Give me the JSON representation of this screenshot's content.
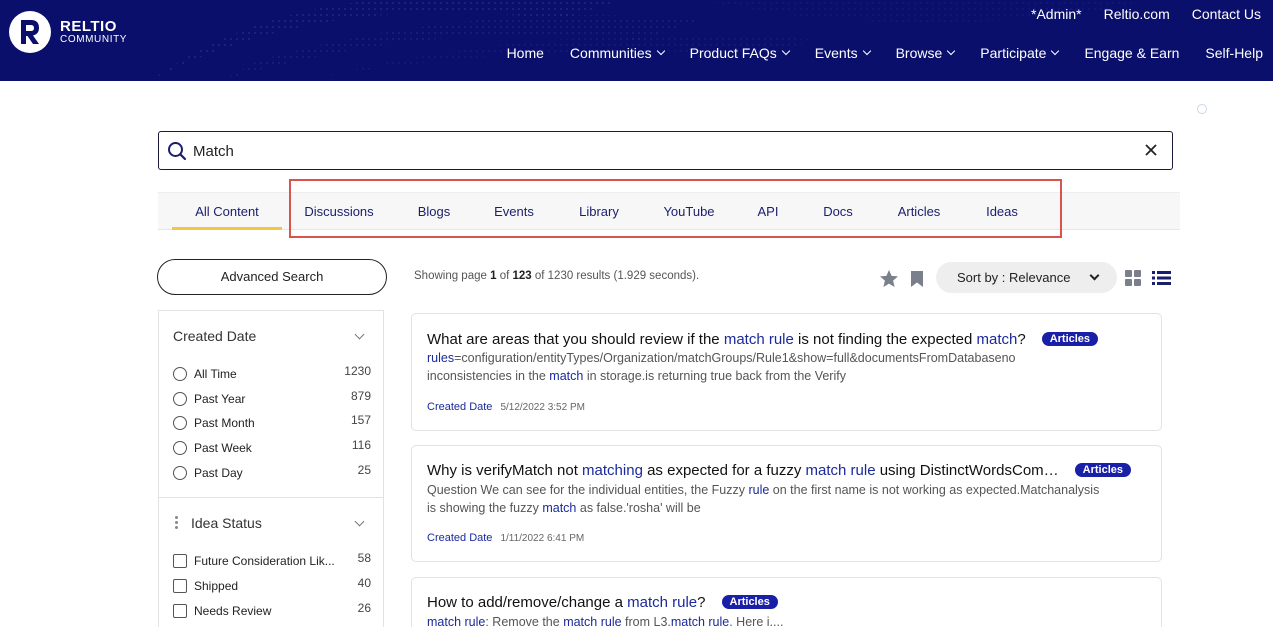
{
  "header": {
    "logo_name": "RELTIO",
    "logo_sub": "COMMUNITY",
    "top_links": [
      "*Admin*",
      "Reltio.com",
      "Contact Us"
    ],
    "nav": [
      {
        "label": "Home",
        "dropdown": false
      },
      {
        "label": "Communities",
        "dropdown": true
      },
      {
        "label": "Product FAQs",
        "dropdown": true
      },
      {
        "label": "Events",
        "dropdown": true
      },
      {
        "label": "Browse",
        "dropdown": true
      },
      {
        "label": "Participate",
        "dropdown": true
      },
      {
        "label": "Engage & Earn",
        "dropdown": false
      },
      {
        "label": "Self-Help",
        "dropdown": false
      }
    ]
  },
  "search": {
    "value": "Match",
    "icon": "search-icon",
    "clear_icon": "close-icon"
  },
  "tabs": [
    {
      "label": "All Content",
      "active": true
    },
    {
      "label": "Discussions",
      "active": false
    },
    {
      "label": "Blogs",
      "active": false
    },
    {
      "label": "Events",
      "active": false
    },
    {
      "label": "Library",
      "active": false
    },
    {
      "label": "YouTube",
      "active": false
    },
    {
      "label": "API",
      "active": false
    },
    {
      "label": "Docs",
      "active": false
    },
    {
      "label": "Articles",
      "active": false
    },
    {
      "label": "Ideas",
      "active": false
    }
  ],
  "sidebar": {
    "advanced_search_label": "Advanced Search",
    "created_date": {
      "title": "Created Date",
      "options": [
        {
          "label": "All Time",
          "count": "1230"
        },
        {
          "label": "Past Year",
          "count": "879"
        },
        {
          "label": "Past Month",
          "count": "157"
        },
        {
          "label": "Past Week",
          "count": "116"
        },
        {
          "label": "Past Day",
          "count": "25"
        }
      ]
    },
    "idea_status": {
      "title": "Idea Status",
      "options": [
        {
          "label": "Future Consideration Lik...",
          "count": "58"
        },
        {
          "label": "Shipped",
          "count": "40"
        },
        {
          "label": "Needs Review",
          "count": "26"
        }
      ]
    }
  },
  "results": {
    "info_prefix": "Showing page ",
    "page": "1",
    "of": " of ",
    "total_pages": "123",
    "info_suffix": " of 1230 results (1.929 seconds).",
    "sort_label": "Sort by : Relevance",
    "items": [
      {
        "title_parts": [
          {
            "text": "What are areas that you should review if the ",
            "hl": false
          },
          {
            "text": "match rule",
            "hl": true
          },
          {
            "text": " is not finding the expected ",
            "hl": false
          },
          {
            "text": "match",
            "hl": true
          },
          {
            "text": "?",
            "hl": false
          }
        ],
        "badge": "Articles",
        "snippet_line1_parts": [
          {
            "text": "rules",
            "hl": true
          },
          {
            "text": "=configuration/entityTypes/Organization/matchGroups/Rule1&show=full&documentsFromDatabaseno",
            "hl": false
          }
        ],
        "snippet_line2_parts": [
          {
            "text": "inconsistencies in the ",
            "hl": false
          },
          {
            "text": "match",
            "hl": true
          },
          {
            "text": " in storage.is returning true back from the Verify",
            "hl": false
          }
        ],
        "meta_label": "Created Date",
        "meta_date": "5/12/2022 3:52 PM"
      },
      {
        "title_parts": [
          {
            "text": "Why is verifyMatch not ",
            "hl": false
          },
          {
            "text": "matching",
            "hl": true
          },
          {
            "text": " as expected for a fuzzy ",
            "hl": false
          },
          {
            "text": "match rule",
            "hl": true
          },
          {
            "text": " using DistinctWordsCom…",
            "hl": false
          }
        ],
        "badge": "Articles",
        "snippet_line1_parts": [
          {
            "text": "Question We can see for the individual entities, the Fuzzy ",
            "hl": false
          },
          {
            "text": "rule",
            "hl": true
          },
          {
            "text": " on the first name is not working as expected.Matchanalysis",
            "hl": false
          }
        ],
        "snippet_line2_parts": [
          {
            "text": "is showing the fuzzy ",
            "hl": false
          },
          {
            "text": "match",
            "hl": true
          },
          {
            "text": " as false.'rosha' will be",
            "hl": false
          }
        ],
        "meta_label": "Created Date",
        "meta_date": "1/11/2022 6:41 PM"
      },
      {
        "title_parts": [
          {
            "text": "How to add/remove/change a ",
            "hl": false
          },
          {
            "text": "match rule",
            "hl": true
          },
          {
            "text": "?",
            "hl": false
          }
        ],
        "badge": "Articles",
        "snippet_line1_parts": [
          {
            "text": "match rule",
            "hl": true
          },
          {
            "text": ": Remove the ",
            "hl": false
          },
          {
            "text": "match rule",
            "hl": true
          },
          {
            "text": " from L3.",
            "hl": false
          },
          {
            "text": "match rule",
            "hl": true
          },
          {
            "text": ".  Here i....",
            "hl": false
          }
        ],
        "snippet_line2_parts": [],
        "meta_label": "",
        "meta_date": ""
      }
    ]
  },
  "colors": {
    "header_bg": "#0a0f6b",
    "accent_underline": "#f2c744",
    "highlight_text": "#1a2a9c",
    "badge_bg": "#1a1fa8",
    "annotation_box": "#d9534f"
  }
}
